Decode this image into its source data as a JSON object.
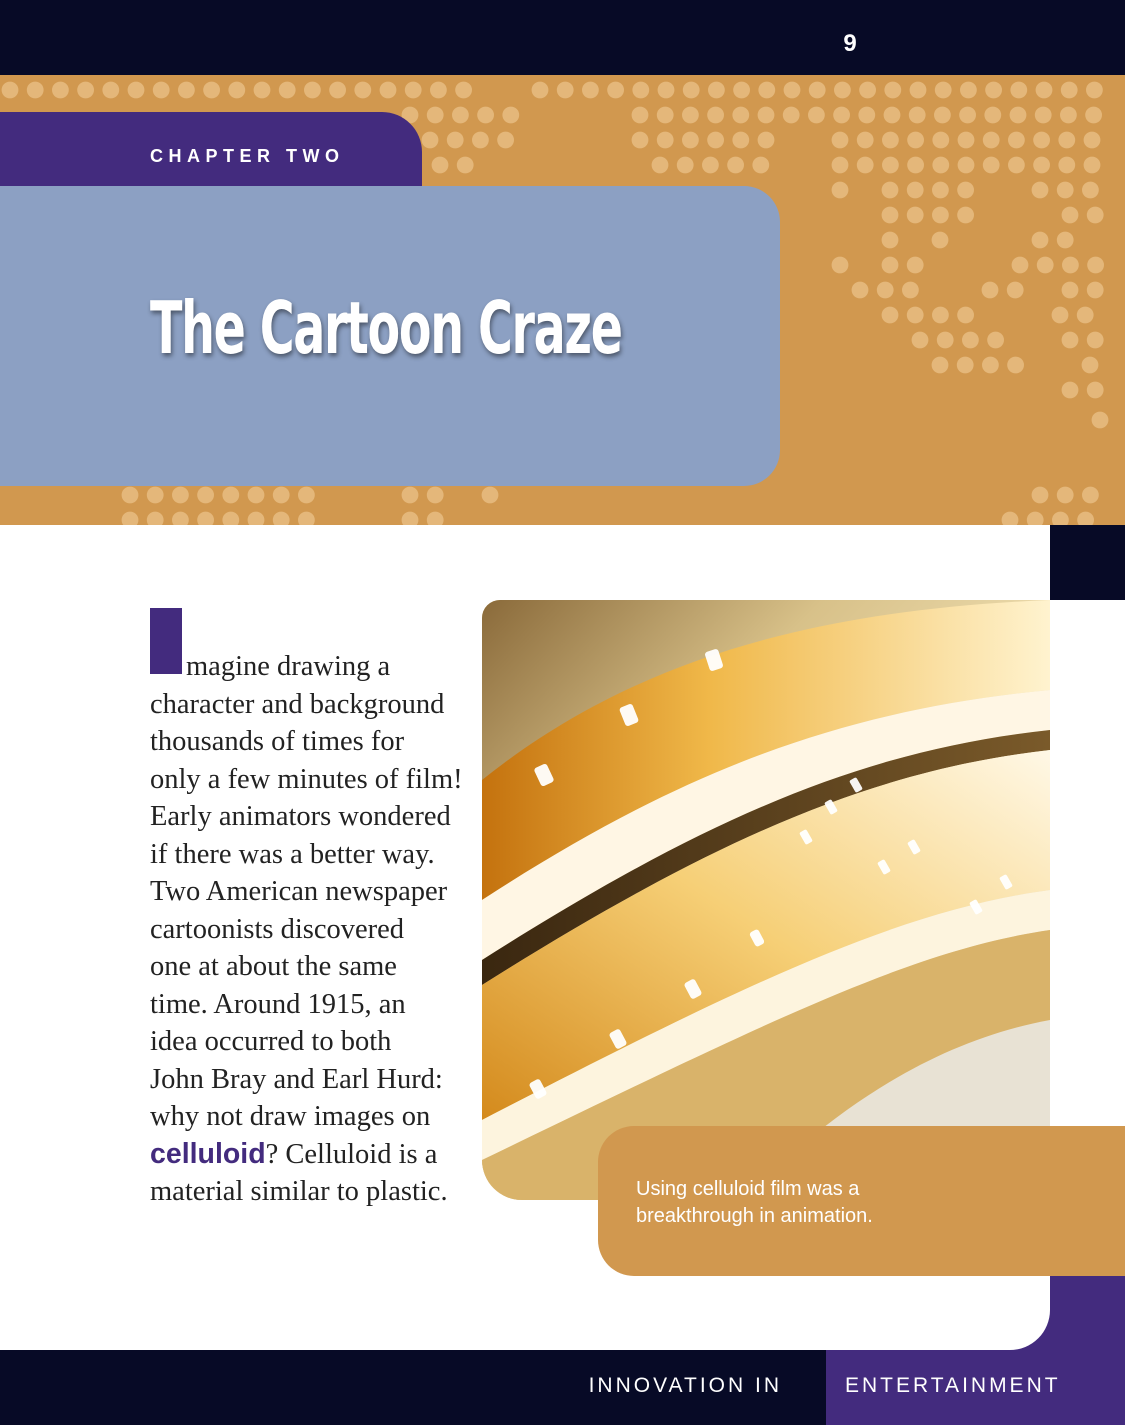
{
  "page": {
    "number": "9"
  },
  "chapter": {
    "label": "CHAPTER TWO",
    "title": "The Cartoon Craze"
  },
  "body": {
    "lines": [
      "magine drawing a",
      "character and background",
      "thousands of times for",
      "only a few minutes of film!",
      "Early animators wondered",
      "if there was a better way.",
      "Two American newspaper",
      "cartoonists discovered",
      "one at about the same",
      "time. Around 1915, an",
      "idea occurred to both",
      "John Bray and Earl Hurd:",
      "why not draw images on"
    ],
    "keyword": "celluloid",
    "after_keyword": "? Celluloid is a",
    "last_line": "material similar to plastic."
  },
  "figure": {
    "caption": "Using celluloid film was a breakthrough in animation."
  },
  "footer": {
    "left": "INNOVATION IN",
    "right": "ENTERTAINMENT"
  },
  "colors": {
    "navy": "#070a26",
    "purple": "#432b7e",
    "orange": "#d1984f",
    "slate_blue": "#8ca0c3",
    "dot": "#e4b77a"
  }
}
